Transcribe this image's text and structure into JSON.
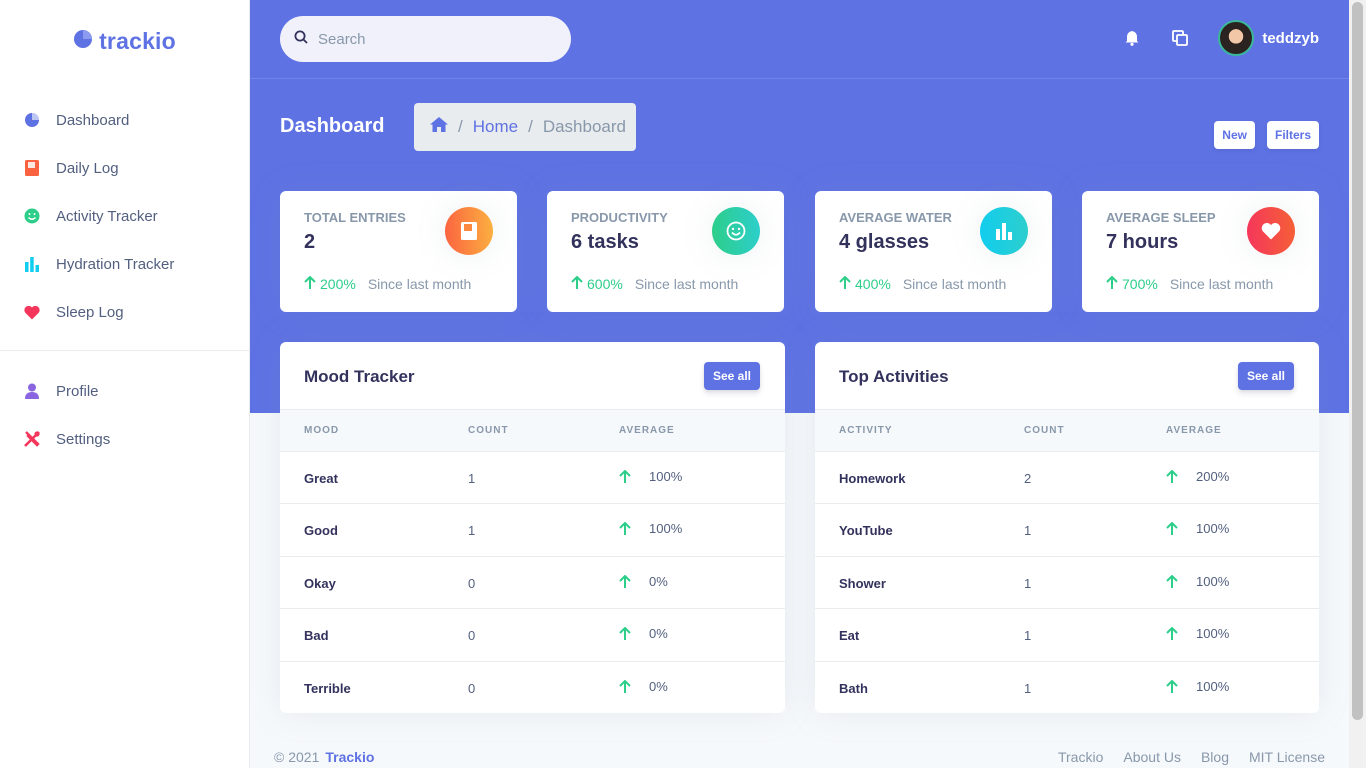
{
  "brand": {
    "name": "trackio"
  },
  "sidebar": {
    "items": [
      {
        "label": "Dashboard",
        "icon": "pie-chart-icon",
        "color": "#5e72e4"
      },
      {
        "label": "Daily Log",
        "icon": "book-icon",
        "color": "#fb6340"
      },
      {
        "label": "Activity Tracker",
        "icon": "smile-icon",
        "color": "#2dce89"
      },
      {
        "label": "Hydration Tracker",
        "icon": "bar-chart-icon",
        "color": "#11cdef"
      },
      {
        "label": "Sleep Log",
        "icon": "heart-icon",
        "color": "#f5365c"
      }
    ],
    "secondary": [
      {
        "label": "Profile",
        "icon": "user-icon",
        "color": "#8965e0"
      },
      {
        "label": "Settings",
        "icon": "tools-icon",
        "color": "#f5365c"
      }
    ]
  },
  "topbar": {
    "search_placeholder": "Search",
    "username": "teddzyb"
  },
  "page": {
    "title": "Dashboard",
    "breadcrumb": {
      "home": "Home",
      "current": "Dashboard",
      "separator": "/"
    },
    "new_label": "New",
    "filters_label": "Filters"
  },
  "stats": [
    {
      "title": "Total entries",
      "value": "2",
      "pct": "200%",
      "since": "Since last month",
      "icon": "book-icon",
      "gradient": [
        "#fb6340",
        "#fbb140"
      ]
    },
    {
      "title": "Productivity",
      "value": "6 tasks",
      "pct": "600%",
      "since": "Since last month",
      "icon": "smile-icon",
      "gradient": [
        "#2dce89",
        "#2dcecc"
      ]
    },
    {
      "title": "Average Water",
      "value": "4 glasses",
      "pct": "400%",
      "since": "Since last month",
      "icon": "bar-chart-icon",
      "gradient": [
        "#11cdef",
        "#1171ef"
      ]
    },
    {
      "title": "Average Sleep",
      "value": "7 hours",
      "pct": "700%",
      "since": "Since last month",
      "icon": "heart-icon",
      "gradient": [
        "#f5365c",
        "#f56036"
      ]
    }
  ],
  "mood": {
    "title": "Mood Tracker",
    "see_all": "See all",
    "columns": [
      "Mood",
      "Count",
      "Average"
    ],
    "rows": [
      {
        "name": "Great",
        "count": "1",
        "average": "100%"
      },
      {
        "name": "Good",
        "count": "1",
        "average": "100%"
      },
      {
        "name": "Okay",
        "count": "0",
        "average": "0%"
      },
      {
        "name": "Bad",
        "count": "0",
        "average": "0%"
      },
      {
        "name": "Terrible",
        "count": "0",
        "average": "0%"
      }
    ]
  },
  "activities": {
    "title": "Top Activities",
    "see_all": "See all",
    "columns": [
      "Activity",
      "Count",
      "Average"
    ],
    "rows": [
      {
        "name": "Homework",
        "count": "2",
        "average": "200%"
      },
      {
        "name": "YouTube",
        "count": "1",
        "average": "100%"
      },
      {
        "name": "Shower",
        "count": "1",
        "average": "100%"
      },
      {
        "name": "Eat",
        "count": "1",
        "average": "100%"
      },
      {
        "name": "Bath",
        "count": "1",
        "average": "100%"
      }
    ]
  },
  "footer": {
    "copyright": "© 2021",
    "brand_link": "Trackio",
    "links": [
      "Trackio",
      "About Us",
      "Blog",
      "MIT License"
    ]
  },
  "colors": {
    "primary": "#5e72e4",
    "success": "#2dce89",
    "muted": "#8898aa"
  }
}
